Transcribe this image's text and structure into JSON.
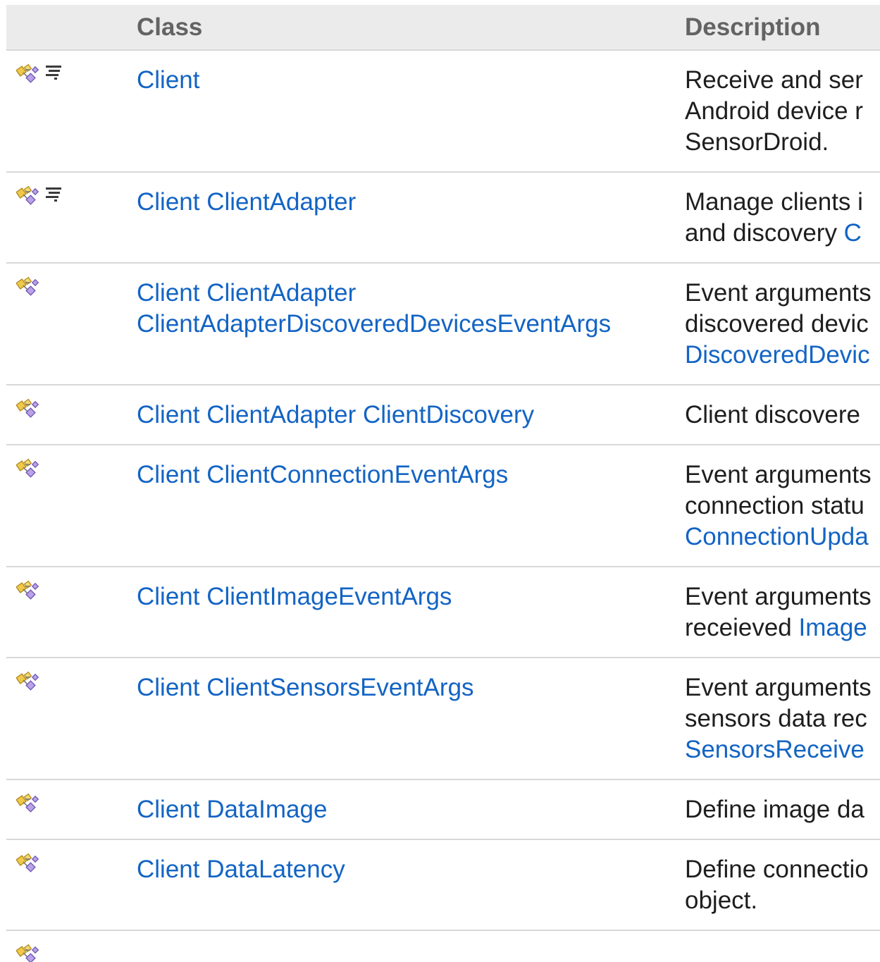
{
  "table": {
    "headers": {
      "icon": "",
      "name": "Class",
      "description": "Description"
    },
    "rows": [
      {
        "icons": [
          "public-class-icon",
          "static-member-icon"
        ],
        "name": [
          "Client"
        ],
        "description": [
          [
            {
              "t": "Receive and ser"
            }
          ],
          [
            {
              "t": "Android device r"
            }
          ],
          [
            {
              "t": "SensorDroid."
            }
          ]
        ]
      },
      {
        "icons": [
          "public-class-icon",
          "static-member-icon"
        ],
        "name": [
          "Client ClientAdapter"
        ],
        "description": [
          [
            {
              "t": "Manage clients i"
            }
          ],
          [
            {
              "t": "and discovery "
            },
            {
              "t": "C",
              "link": true
            }
          ]
        ]
      },
      {
        "icons": [
          "public-class-icon"
        ],
        "name": [
          "Client ClientAdapter",
          "ClientAdapterDiscoveredDevicesEventArgs"
        ],
        "description": [
          [
            {
              "t": "Event arguments"
            }
          ],
          [
            {
              "t": "discovered devic"
            }
          ],
          [
            {
              "t": "DiscoveredDevic",
              "link": true
            }
          ]
        ]
      },
      {
        "icons": [
          "public-class-icon"
        ],
        "name": [
          "Client ClientAdapter ClientDiscovery"
        ],
        "description": [
          [
            {
              "t": "Client discovere"
            }
          ]
        ]
      },
      {
        "icons": [
          "public-class-icon"
        ],
        "name": [
          "Client ClientConnectionEventArgs"
        ],
        "description": [
          [
            {
              "t": "Event arguments"
            }
          ],
          [
            {
              "t": "connection statu"
            }
          ],
          [
            {
              "t": "ConnectionUpda",
              "link": true
            }
          ]
        ]
      },
      {
        "icons": [
          "public-class-icon"
        ],
        "name": [
          "Client ClientImageEventArgs"
        ],
        "description": [
          [
            {
              "t": "Event arguments"
            }
          ],
          [
            {
              "t": "receieved "
            },
            {
              "t": "Image",
              "link": true
            }
          ]
        ]
      },
      {
        "icons": [
          "public-class-icon"
        ],
        "name": [
          "Client ClientSensorsEventArgs"
        ],
        "description": [
          [
            {
              "t": "Event arguments"
            }
          ],
          [
            {
              "t": "sensors data rec"
            }
          ],
          [
            {
              "t": "SensorsReceive",
              "link": true
            }
          ]
        ]
      },
      {
        "icons": [
          "public-class-icon"
        ],
        "name": [
          "Client DataImage"
        ],
        "description": [
          [
            {
              "t": "Define image da"
            }
          ]
        ]
      },
      {
        "icons": [
          "public-class-icon"
        ],
        "name": [
          "Client DataLatency"
        ],
        "description": [
          [
            {
              "t": "Define connectio"
            }
          ],
          [
            {
              "t": "object."
            }
          ]
        ]
      },
      {
        "icons": [
          "public-class-icon"
        ],
        "name": [],
        "description": []
      }
    ]
  }
}
